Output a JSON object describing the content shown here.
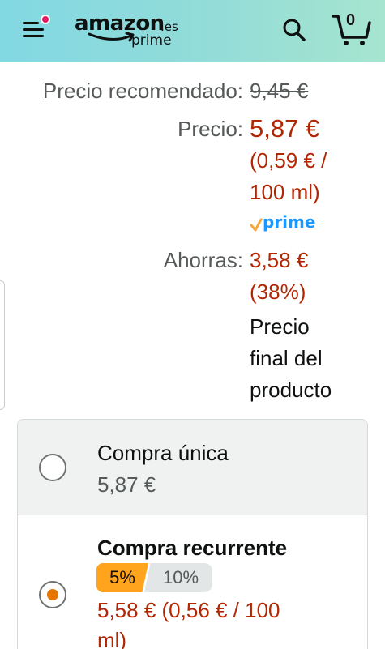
{
  "header": {
    "logo_word": "amazon",
    "logo_domain": ".es",
    "logo_sub": "prime",
    "cart_count": "0",
    "colors": {
      "gradient_start": "#82d8e3",
      "gradient_end": "#a6e5cf",
      "notification_dot": "#e31a65"
    },
    "icons": [
      "menu-icon",
      "search-icon",
      "cart-icon"
    ]
  },
  "price": {
    "recommended_label": "Precio recomendado:",
    "recommended_value": "9,45 €",
    "price_label": "Precio:",
    "price_value": "5,87 €",
    "unit_price_line1": "(0,59 € /",
    "unit_price_line2": "100 ml)",
    "prime_badge": "prime",
    "savings_label": "Ahorras:",
    "savings_value": "3,58 €",
    "savings_percent": "(38%)",
    "final_note_line1": "Precio",
    "final_note_line2": "final del",
    "final_note_line3": "producto"
  },
  "options": {
    "once": {
      "title": "Compra única",
      "price": "5,87 €",
      "selected": false
    },
    "subscribe": {
      "title": "Compra recurrente",
      "discount_a": "5%",
      "discount_b": "10%",
      "price_line1": "5,58 € (0,56 € / 100",
      "price_line2": "ml)",
      "selected": true
    }
  },
  "colors": {
    "deal_red": "#b12704",
    "accent_orange": "#e77600",
    "badge_orange": "#ffa41c",
    "prime_blue": "#1a98ff"
  }
}
